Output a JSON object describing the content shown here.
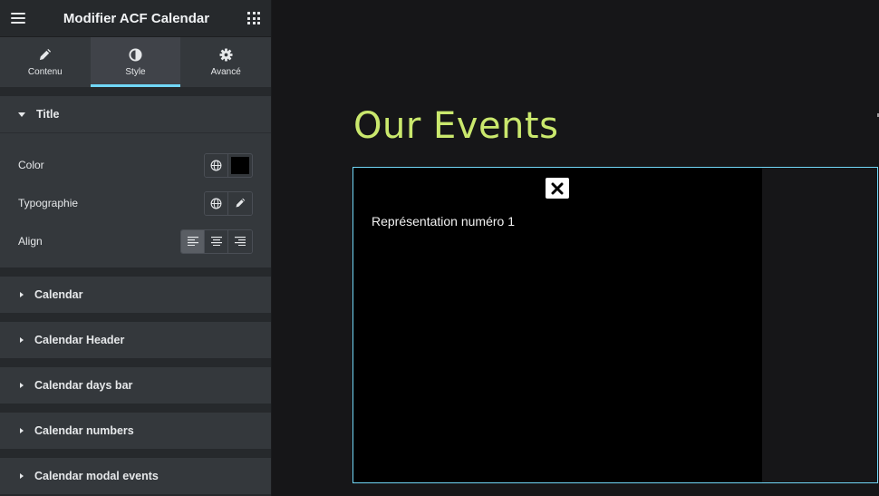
{
  "panel": {
    "title": "Modifier ACF Calendar",
    "tabs": [
      {
        "label": "Contenu",
        "icon": "pencil-icon"
      },
      {
        "label": "Style",
        "icon": "contrast-icon"
      },
      {
        "label": "Avancé",
        "icon": "gear-icon"
      }
    ],
    "active_tab": "Style",
    "open_section": {
      "title": "Title",
      "controls": {
        "color_label": "Color",
        "color_value": "#000000",
        "typography_label": "Typographie",
        "align_label": "Align",
        "align_options": [
          "left",
          "center",
          "right"
        ],
        "align_selected": "left"
      }
    },
    "sections": [
      {
        "title": "Calendar"
      },
      {
        "title": "Calendar Header"
      },
      {
        "title": "Calendar days bar"
      },
      {
        "title": "Calendar numbers"
      },
      {
        "title": "Calendar modal events"
      }
    ]
  },
  "preview": {
    "heading": "Our Events",
    "modal_event_text": "Représentation numéro 1"
  },
  "colors": {
    "accent": "#71d7f7",
    "heading": "#cae86d",
    "panel_bg": "#26292c",
    "section_bg": "#34383c"
  }
}
